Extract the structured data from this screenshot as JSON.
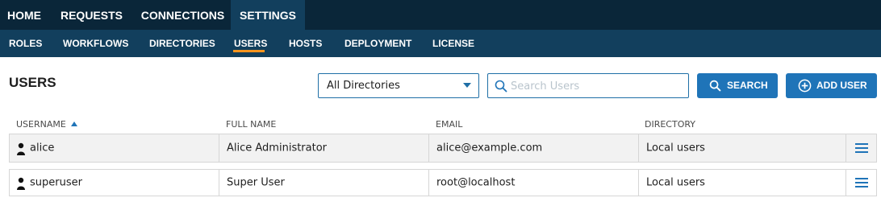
{
  "top_nav": {
    "tabs": [
      {
        "label": "HOME"
      },
      {
        "label": "REQUESTS"
      },
      {
        "label": "CONNECTIONS"
      },
      {
        "label": "SETTINGS",
        "active": true
      }
    ]
  },
  "sub_nav": {
    "items": [
      {
        "label": "ROLES"
      },
      {
        "label": "WORKFLOWS"
      },
      {
        "label": "DIRECTORIES"
      },
      {
        "label": "USERS",
        "active": true
      },
      {
        "label": "HOSTS"
      },
      {
        "label": "DEPLOYMENT"
      },
      {
        "label": "LICENSE"
      }
    ]
  },
  "page": {
    "title": "USERS"
  },
  "toolbar": {
    "directory_select": {
      "value": "All Directories"
    },
    "search": {
      "placeholder": "Search Users",
      "value": ""
    },
    "search_button": "SEARCH",
    "add_user_button": "ADD USER"
  },
  "table": {
    "columns": [
      "USERNAME",
      "FULL NAME",
      "EMAIL",
      "DIRECTORY"
    ],
    "sort_column": "USERNAME",
    "sort_direction": "ascending",
    "rows": [
      {
        "username": "alice",
        "full_name": "Alice Administrator",
        "email": "alice@example.com",
        "directory": "Local users"
      },
      {
        "username": "superuser",
        "full_name": "Super User",
        "email": "root@localhost",
        "directory": "Local users"
      }
    ]
  },
  "colors": {
    "nav_dark": "#0a2639",
    "nav": "#123f5d",
    "accent": "#f7941d",
    "primary": "#1f74b8"
  },
  "icons": [
    "search-icon",
    "plus-circle-icon",
    "user-icon",
    "menu-icon",
    "chevron-down-icon",
    "sort-asc-icon"
  ]
}
